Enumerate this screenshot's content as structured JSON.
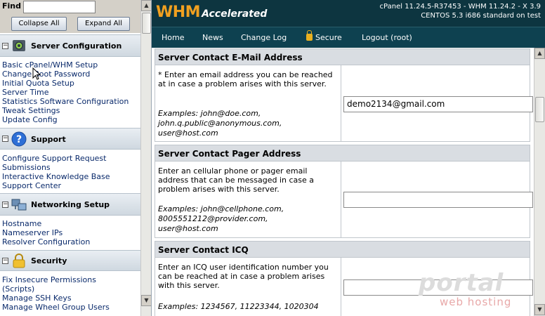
{
  "sidebar": {
    "find_label": "Find",
    "find_value": "",
    "collapse_label": "Collapse All",
    "expand_label": "Expand All",
    "sections": [
      {
        "title": "Server Configuration",
        "items": [
          {
            "label": "Basic cPanel/WHM Setup"
          },
          {
            "label": "Change Root Password"
          },
          {
            "label": "Initial Quota Setup"
          },
          {
            "label": "Server Time"
          },
          {
            "label": "Statistics Software Configuration"
          },
          {
            "label": "Tweak Settings"
          },
          {
            "label": "Update Config"
          }
        ]
      },
      {
        "title": "Support",
        "items": [
          {
            "label": "Configure Support Request"
          },
          {
            "label": "Submissions"
          },
          {
            "label": "Interactive Knowledge Base"
          },
          {
            "label": "Support Center"
          }
        ]
      },
      {
        "title": "Networking Setup",
        "items": [
          {
            "label": "Hostname"
          },
          {
            "label": "Nameserver IPs"
          },
          {
            "label": "Resolver Configuration"
          }
        ]
      },
      {
        "title": "Security",
        "items": [
          {
            "label": "Fix Insecure Permissions"
          },
          {
            "label": "(Scripts)"
          },
          {
            "label": "Manage SSH Keys"
          },
          {
            "label": "Manage Wheel Group Users"
          }
        ]
      }
    ]
  },
  "header": {
    "logo_main": "WHM",
    "logo_sub": "Accelerated",
    "version_line1": "cPanel 11.24.5-R37453 - WHM 11.24.2 - X 3.9",
    "version_line2": "CENTOS 5.3 i686 standard on test"
  },
  "nav": {
    "home": "Home",
    "news": "News",
    "changelog": "Change Log",
    "secure": "Secure",
    "logout": "Logout (root)"
  },
  "form": {
    "email": {
      "title": "Server Contact E-Mail Address",
      "description": "* Enter an email address you can be reached at in case a problem arises with this server.",
      "examples": [
        "Examples: john@doe.com,",
        "john.q.public@anonymous.com,",
        "user@host.com"
      ],
      "value": "demo2134@gmail.com"
    },
    "pager": {
      "title": "Server Contact Pager Address",
      "description": "Enter an cellular phone or pager email address that can be messaged in case a problem arises with this server.",
      "examples": [
        "Examples: john@cellphone.com,",
        "8005551212@provider.com,",
        "user@host.com"
      ],
      "value": ""
    },
    "icq": {
      "title": "Server Contact ICQ",
      "description": "Enter an ICQ user identification number you can be reached at in case a problem arises with this server.",
      "examples": [
        "Examples: 1234567, 11223344, 1020304"
      ],
      "value": ""
    }
  },
  "watermark": {
    "main": "portal",
    "sub": "web hosting"
  },
  "colors": {
    "header_bg": "#0d3540",
    "nav_bg": "#0e4150",
    "logo_orange": "#f0a020",
    "link_blue": "#0a2a6b"
  }
}
